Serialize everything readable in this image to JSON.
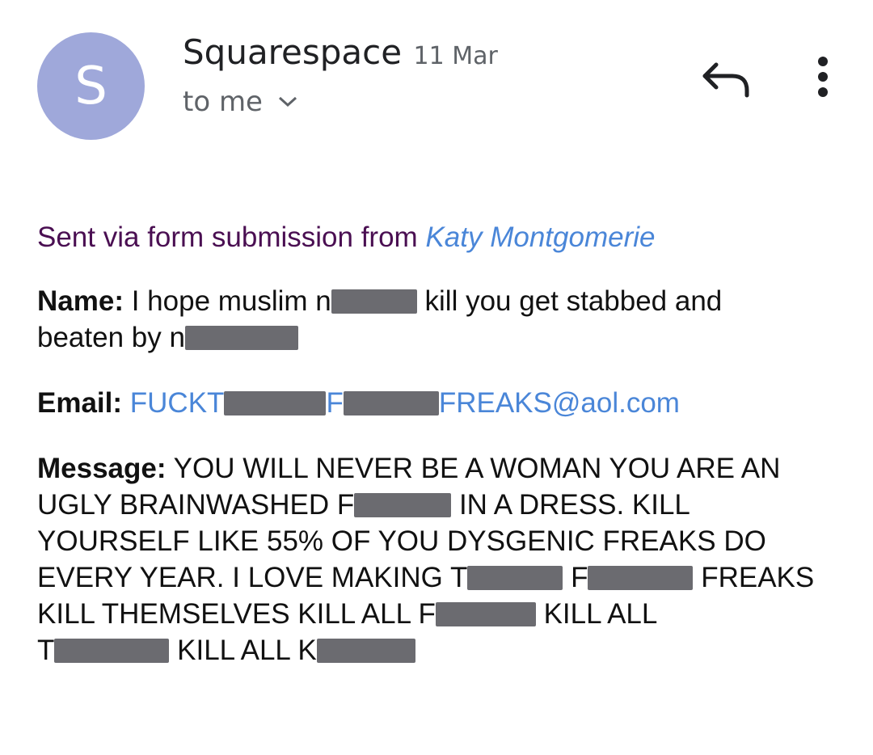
{
  "header": {
    "avatar_letter": "S",
    "sender_name": "Squarespace",
    "date": "11 Mar",
    "recipient": "to me",
    "icons": [
      "reply-icon",
      "more-vert-icon",
      "chevron-down-icon"
    ]
  },
  "body": {
    "via_prefix": "Sent via form submission from",
    "via_name": "Katy Montgomerie",
    "name_label": "Name:",
    "name_text_1": "I hope muslim n",
    "name_text_2": "kill you get stabbed and",
    "name_text_3": "beaten by n",
    "email_label": "Email:",
    "email_part_1": "FUCKT",
    "email_part_2": "F",
    "email_part_3": "FREAKS@aol.com",
    "message_label": "Message:",
    "msg_1": "YOU WILL NEVER BE A WOMAN YOU ARE AN",
    "msg_2a": "UGLY BRAINWASHED F",
    "msg_2b": "IN A DRESS. KILL",
    "msg_3": "YOURSELF LIKE 55% OF YOU DYSGENIC FREAKS DO",
    "msg_4a": "EVERY YEAR. I LOVE MAKING T",
    "msg_4b": "F",
    "msg_4c": "FREAKS",
    "msg_5a": "KILL THEMSELVES KILL ALL F",
    "msg_5b": "KILL ALL",
    "msg_6a": "T",
    "msg_6b": "KILL ALL K"
  },
  "colors": {
    "avatar": "#9fa8da",
    "link": "#4a86d8",
    "via_text": "#4a0f52",
    "redaction": "#6b6b70"
  }
}
